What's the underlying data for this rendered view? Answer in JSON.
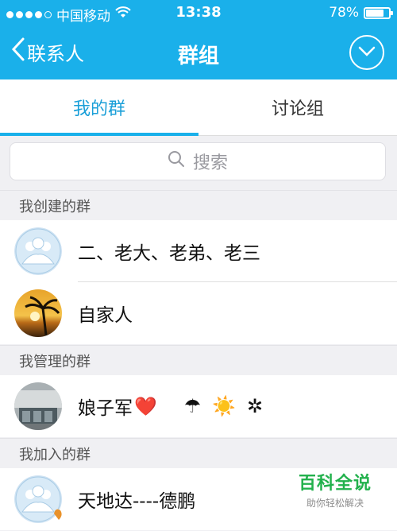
{
  "status_bar": {
    "carrier": "中国移动",
    "time": "13:38",
    "battery_percent": "78%",
    "battery_level": 0.78
  },
  "nav": {
    "back_label": "联系人",
    "title": "群组"
  },
  "tabs": [
    {
      "label": "我的群",
      "active": true
    },
    {
      "label": "讨论组",
      "active": false
    }
  ],
  "search": {
    "placeholder": "搜索"
  },
  "sections": [
    {
      "header": "我创建的群",
      "items": [
        {
          "name": "二、老大、老弟、老三",
          "avatar": "default-group-avatar"
        },
        {
          "name": "自家人",
          "avatar": "palm-sunset-photo"
        }
      ]
    },
    {
      "header": "我管理的群",
      "items": [
        {
          "name": "娘子军",
          "avatar": "building-photo",
          "emoji": [
            "❤️",
            "☂",
            "☀️",
            "✲"
          ]
        }
      ]
    },
    {
      "header": "我加入的群",
      "items": [
        {
          "name": "天地达----德鹏",
          "avatar": "default-group-avatar"
        }
      ]
    }
  ],
  "watermark": {
    "title": "百科全说",
    "subtitle": "助你轻松解决"
  },
  "colors": {
    "accent": "#1ab0ea",
    "tab_active": "#1a9fd8",
    "watermark_green": "#22b14c"
  }
}
